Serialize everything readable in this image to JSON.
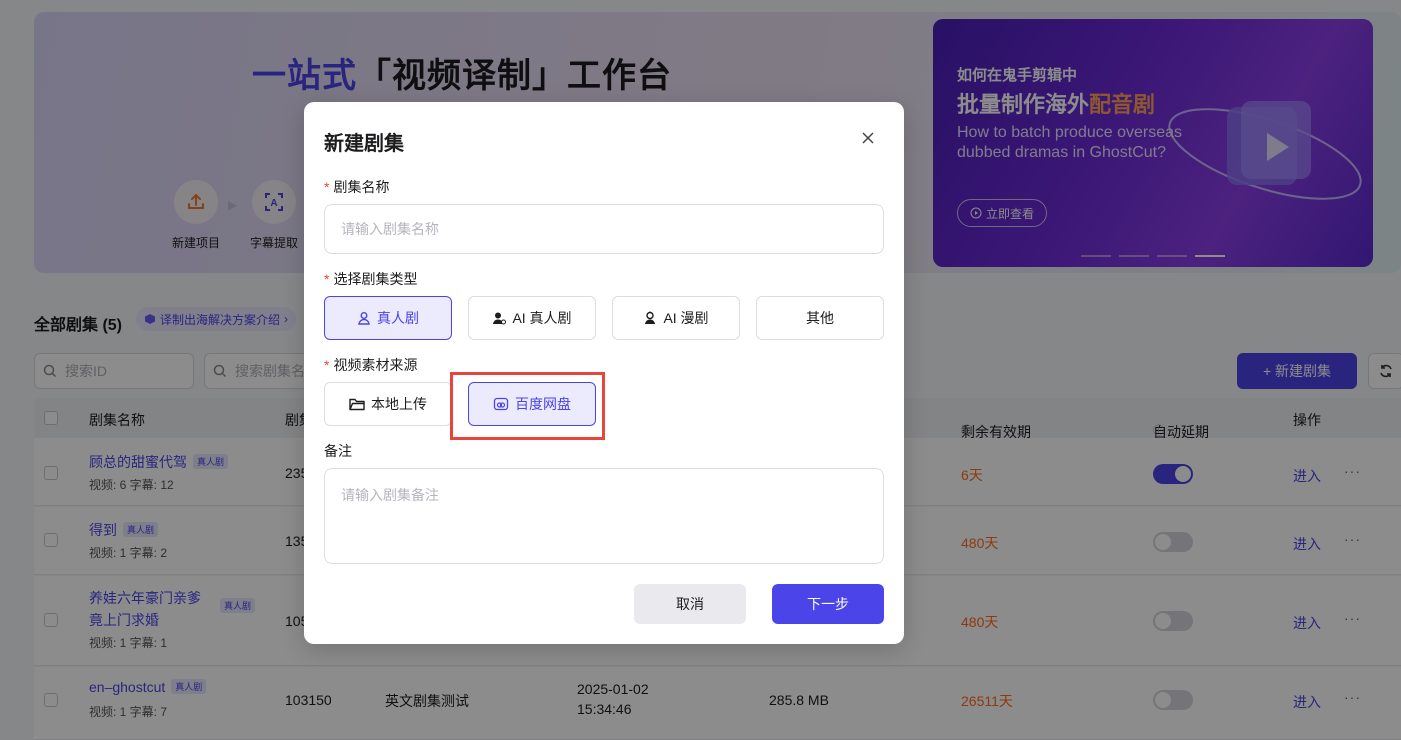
{
  "hero": {
    "title_accent": "一站式",
    "title_rest": "「视频译制」工作台",
    "steps": [
      {
        "label": "新建项目",
        "icon": "upload-icon"
      },
      {
        "label": "字幕提取",
        "icon": "text-scan-icon"
      }
    ]
  },
  "banner": {
    "subtitle": "如何在鬼手剪辑中",
    "main_prefix": "批量制作海外",
    "main_highlight": "配音剧",
    "english": "How to batch produce overseas dubbed dramas in GhostCut?",
    "button_label": "立即查看"
  },
  "list": {
    "title": "全部剧集 (5)",
    "solution_link": "译制出海解决方案介绍",
    "search_id_placeholder": "搜索ID",
    "search_name_placeholder": "搜索剧集名",
    "new_button": "+ 新建剧集",
    "columns": {
      "name": "剧集名称",
      "id": "剧集",
      "remaining": "剩余有效期",
      "auto_extend": "自动延期",
      "action": "操作"
    },
    "rows": [
      {
        "name": "顾总的甜蜜代驾",
        "tag": "真人剧",
        "meta": "视频: 6   字幕: 12",
        "id": "235",
        "days": "6天",
        "auto": true,
        "enter": "进入",
        "more": "···"
      },
      {
        "name": "得到",
        "tag": "真人剧",
        "meta": "视频: 1   字幕: 2",
        "id": "135",
        "days": "480天",
        "auto": false,
        "enter": "进入",
        "more": "···"
      },
      {
        "name": "养娃六年豪门亲爹",
        "name2": "竟上门求婚",
        "tag": "真人剧",
        "meta": "视频: 1   字幕: 1",
        "id": "105",
        "days": "480天",
        "auto": false,
        "enter": "进入",
        "more": "···"
      },
      {
        "name": "en–ghostcut",
        "tag": "真人剧",
        "meta": "视频: 1   字幕: 7",
        "id": "103150",
        "remark": "英文剧集测试",
        "date": "2025-01-02",
        "time": "15:34:46",
        "size": "285.8 MB",
        "days": "26511天",
        "auto": false,
        "enter": "进入",
        "more": "···"
      }
    ]
  },
  "modal": {
    "title": "新建剧集",
    "name_label": "剧集名称",
    "name_placeholder": "请输入剧集名称",
    "type_label": "选择剧集类型",
    "types": [
      {
        "label": "真人剧",
        "icon": "person-icon",
        "selected": true
      },
      {
        "label": "AI 真人剧",
        "icon": "ai-person-icon",
        "selected": false
      },
      {
        "label": "AI 漫剧",
        "icon": "ai-comic-icon",
        "selected": false
      },
      {
        "label": "其他",
        "icon": "",
        "selected": false
      }
    ],
    "source_label": "视频素材来源",
    "sources": [
      {
        "label": "本地上传",
        "icon": "folder-icon",
        "selected": false
      },
      {
        "label": "百度网盘",
        "icon": "cloud-drive-icon",
        "selected": true
      }
    ],
    "remark_label": "备注",
    "remark_placeholder": "请输入剧集备注",
    "cancel": "取消",
    "next": "下一步"
  },
  "colors": {
    "accent": "#4b44e8",
    "danger": "#e8453c",
    "days": "#ff6a1a"
  }
}
